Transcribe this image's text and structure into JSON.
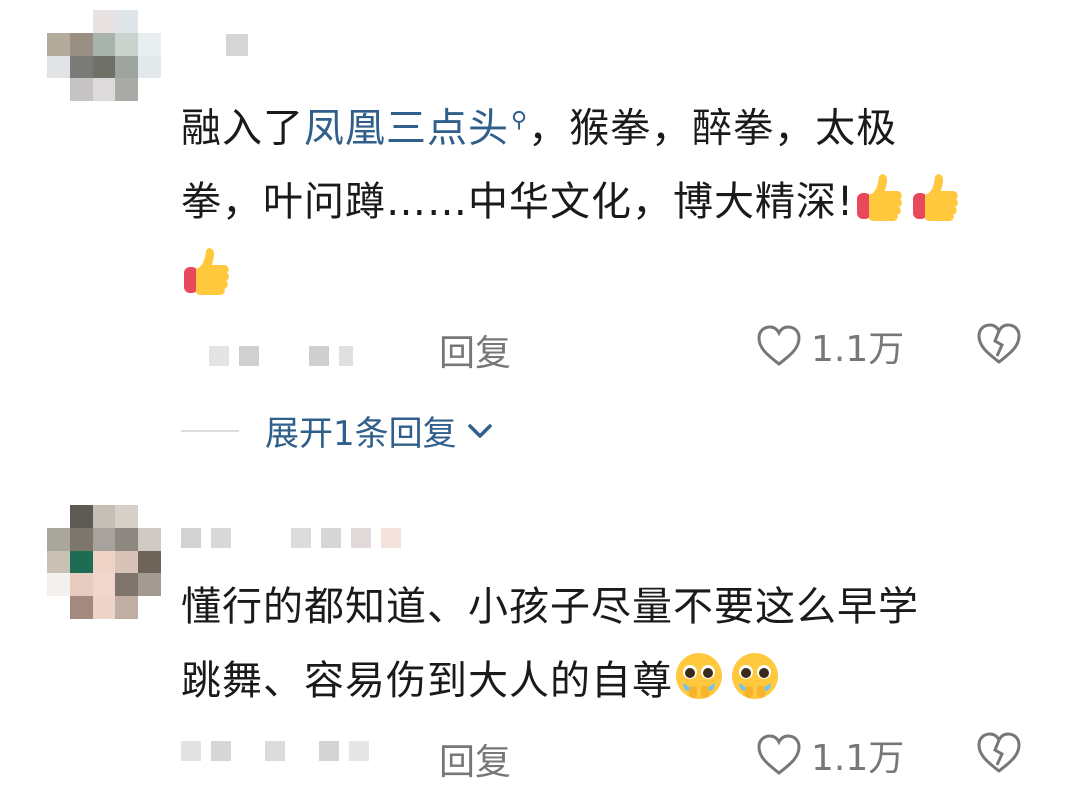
{
  "comments": [
    {
      "text_prefix": "融入了",
      "link_text": "凤凰三点头",
      "text_line1_suffix": "，猴拳，醉拳，太极",
      "text_line2": "拳，叶问蹲……中华文化，博大精深!",
      "reply_label": "回复",
      "like_count": "1.1万",
      "emoji": "thumbs-up"
    },
    {
      "text_line1": "懂行的都知道、小孩子尽量不要这么早学",
      "text_line2": "跳舞、容易伤到大人的自尊",
      "reply_label": "回复",
      "like_count": "1.1万",
      "emoji": "pleading-face"
    }
  ],
  "expand_replies": {
    "label": "展开1条回复"
  },
  "colors": {
    "link": "#2f5f8a",
    "muted": "#777777",
    "emoji_yellow": "#ffc83d",
    "emoji_red": "#e8485b"
  }
}
